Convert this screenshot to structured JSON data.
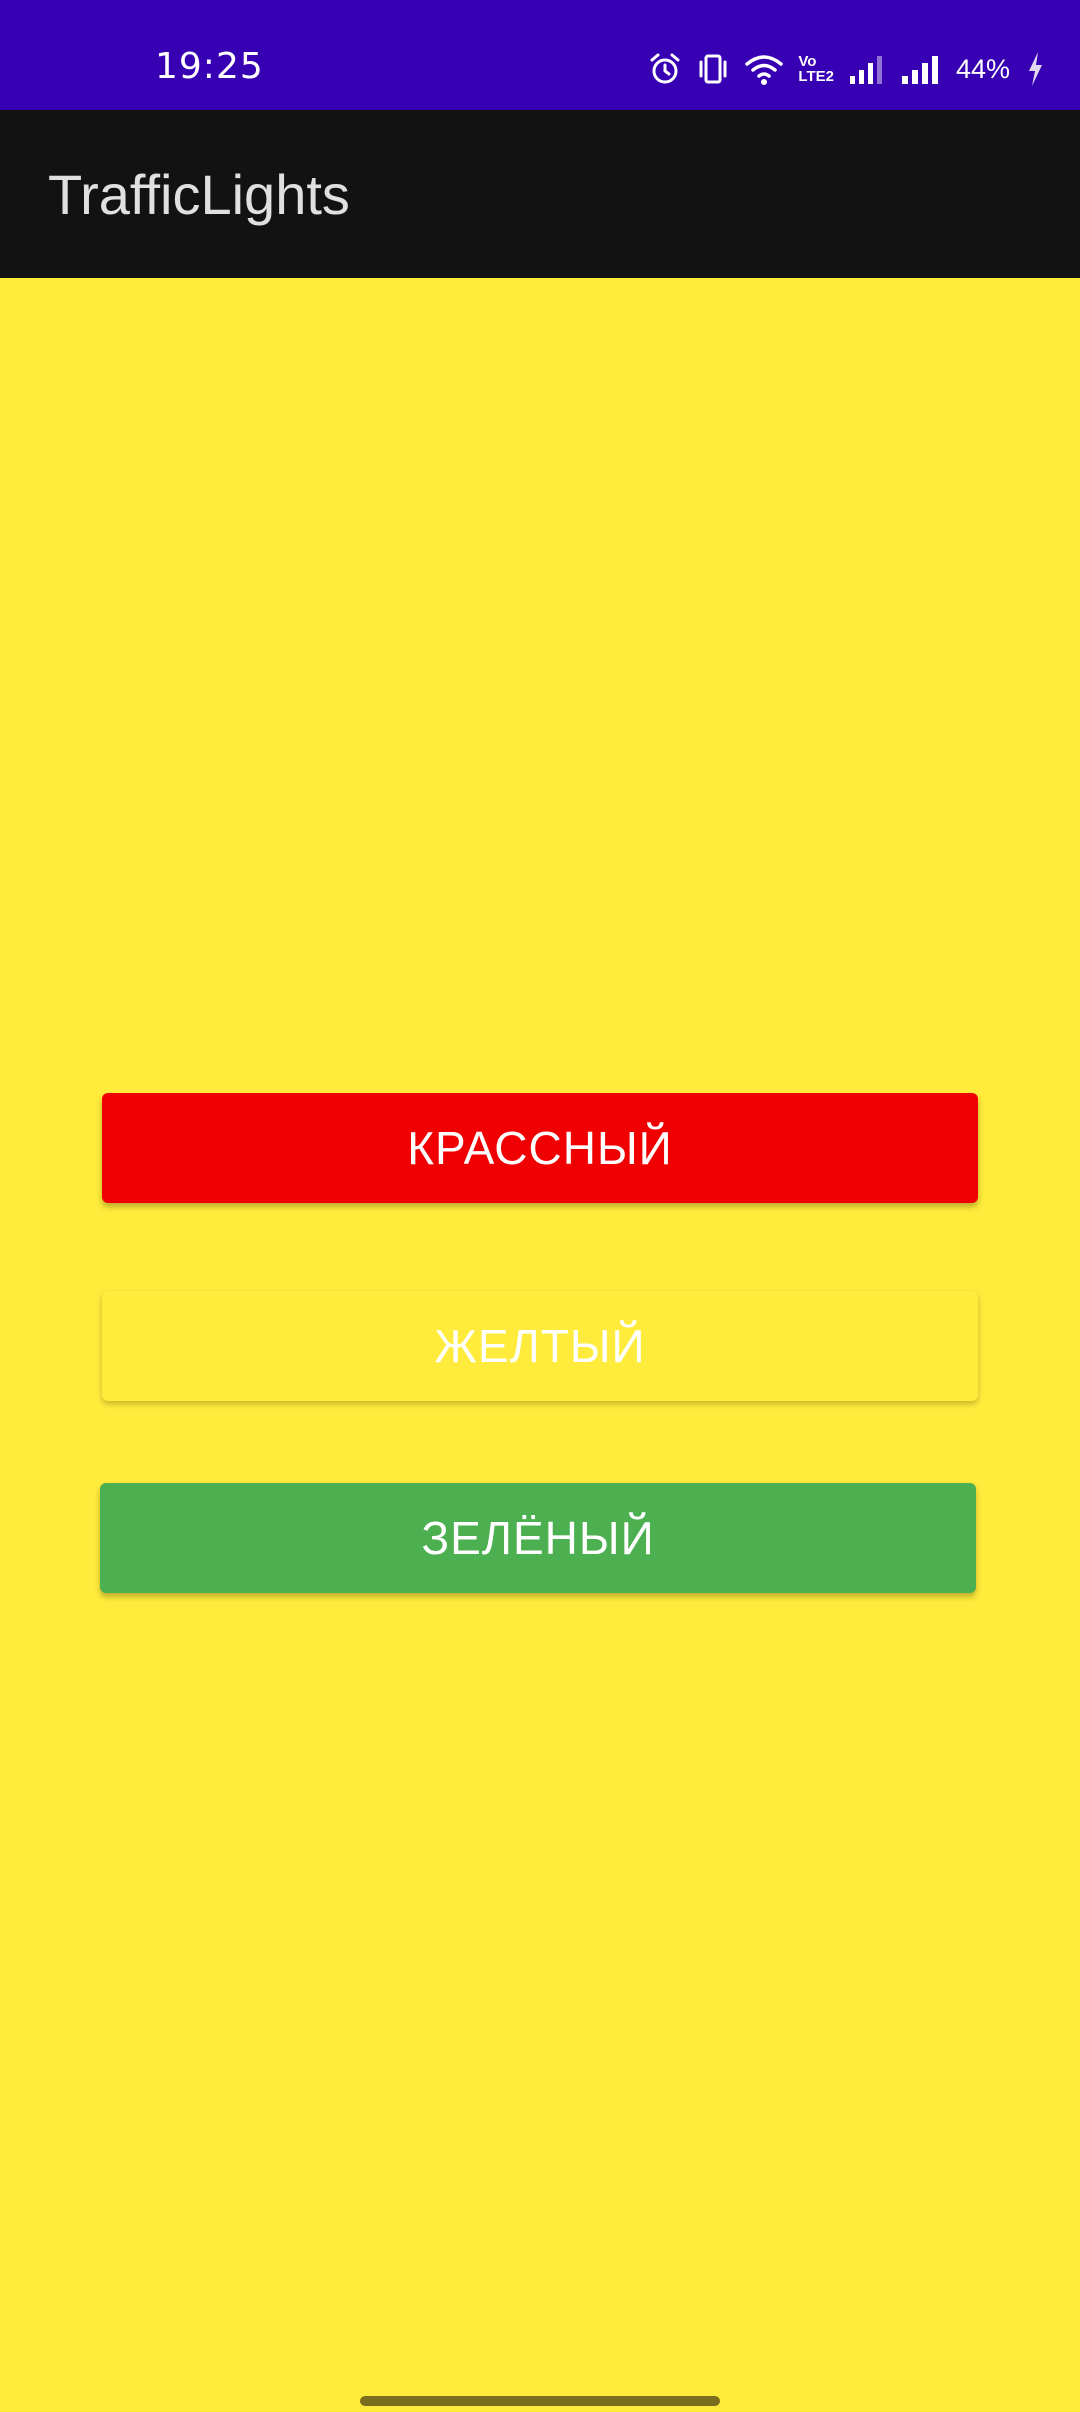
{
  "status_bar": {
    "time": "19:25",
    "battery": "44%",
    "volte_top": "Vo",
    "volte_bottom": "LTE2",
    "icons": [
      "alarm-icon",
      "vibrate-icon",
      "wifi-icon",
      "volte-icon",
      "signal-icon",
      "signal-icon",
      "charging-icon"
    ],
    "background": "#3700B3"
  },
  "app_bar": {
    "title": "TrafficLights",
    "background": "#121212"
  },
  "buttons": {
    "red": {
      "label": "КРАССНЫЙ",
      "color": "#F00000"
    },
    "yellow": {
      "label": "ЖЕЛТЫЙ",
      "color": "#FFEB3B"
    },
    "green": {
      "label": "ЗЕЛЁНЫЙ",
      "color": "#4CAF50"
    }
  },
  "screen_background": "#FFEB3B"
}
